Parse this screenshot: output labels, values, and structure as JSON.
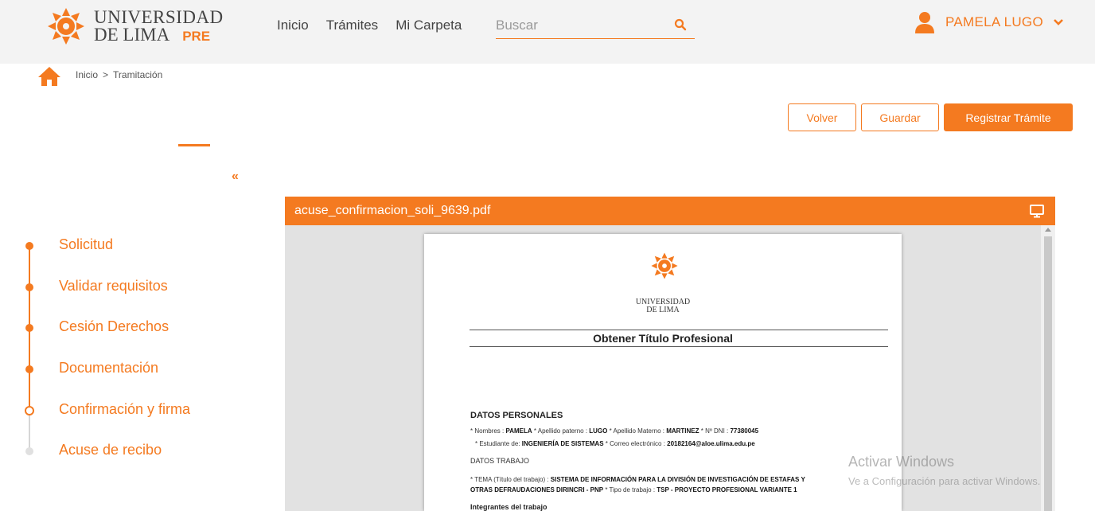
{
  "header": {
    "logo_line1": "UNIVERSIDAD",
    "logo_line2": "DE LIMA",
    "logo_tag": "PRE",
    "nav": [
      "Inicio",
      "Trámites",
      "Mi Carpeta"
    ],
    "search_placeholder": "Buscar",
    "user_name": "PAMELA LUGO",
    "accent": "#f47a20"
  },
  "breadcrumb": {
    "items": [
      "Inicio",
      "Tramitación"
    ],
    "separator": ">"
  },
  "actions": {
    "back": "Volver",
    "save": "Guardar",
    "submit": "Registrar Trámite"
  },
  "sidebar": {
    "collapse_label": "«",
    "steps": [
      {
        "label": "Solicitud",
        "state": "done"
      },
      {
        "label": "Validar requisitos",
        "state": "done"
      },
      {
        "label": "Cesión Derechos",
        "state": "done"
      },
      {
        "label": "Documentación",
        "state": "done"
      },
      {
        "label": "Confirmación y firma",
        "state": "current"
      },
      {
        "label": "Acuse de recibo",
        "state": "pending"
      }
    ]
  },
  "viewer": {
    "filename": "acuse_confirmacion_soli_9639.pdf",
    "doc": {
      "uni_line1": "UNIVERSIDAD",
      "uni_line2": "DE LIMA",
      "title": "Obtener Título Profesional",
      "personal_heading": "DATOS PERSONALES",
      "p1_a": "* Nombres : ",
      "p1_b": "PAMELA",
      "p1_c": "  * Apellido paterno : ",
      "p1_d": "LUGO",
      "p1_e": "  * Apellido Materno : ",
      "p1_f": "MARTINEZ",
      "p1_g": "  * Nº DNI : ",
      "p1_h": "77380045",
      "p2_a": "* Estudiante de: ",
      "p2_b": "INGENIERÍA DE SISTEMAS",
      "p2_c": "  * Correo electrónico : ",
      "p2_d": "20182164@aloe.ulima.edu.pe",
      "work_heading": "DATOS TRABAJO",
      "w1_a": "* TEMA (Título del trabajo) : ",
      "w1_b": "SISTEMA DE INFORMACIÓN PARA LA DIVISIÓN DE INVESTIGACIÓN DE ESTAFAS Y",
      "w2_a": "OTRAS DEFRAUDACIONES DIRINCRI - PNP",
      "w2_b": "  * Tipo de trabajo : ",
      "w2_c": "TSP - PROYECTO PROFESIONAL VARIANTE 1",
      "members_heading": "Integrantes del trabajo"
    }
  },
  "watermark": {
    "line1": "Activar Windows",
    "line2": "Ve a Configuración para activar Windows."
  }
}
